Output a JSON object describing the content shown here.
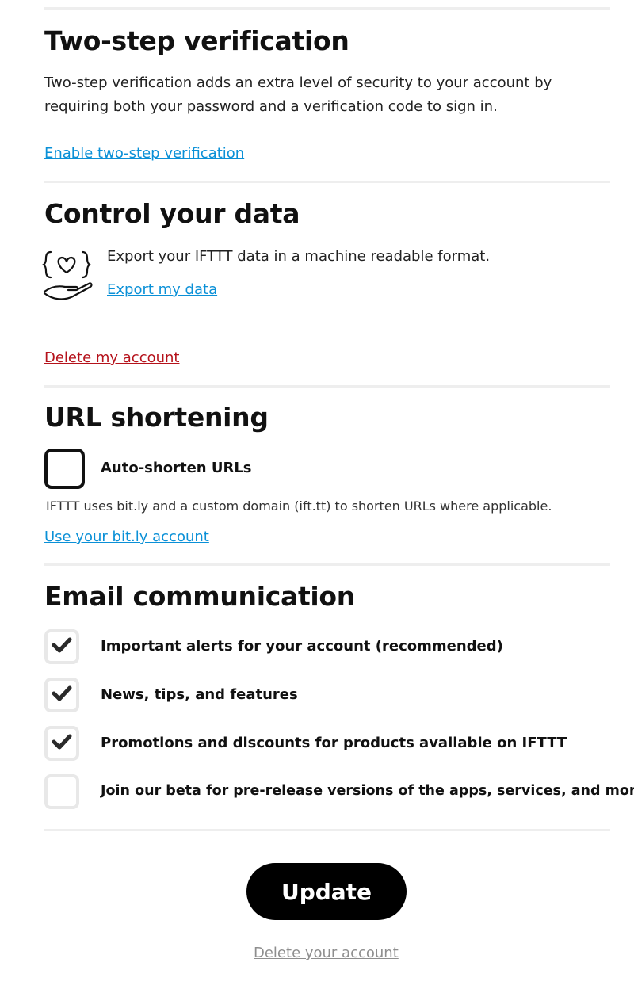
{
  "two_step": {
    "title": "Two-step verification",
    "description": "Two-step verification adds an extra level of security to your account by requiring both your password and a verification code to sign in.",
    "enable_link": "Enable two-step verification"
  },
  "control_data": {
    "title": "Control your data",
    "export_text": "Export your IFTTT data in a machine readable format.",
    "export_link": "Export my data",
    "delete_link": "Delete my account",
    "icon": "hand-heart-icon"
  },
  "url_shortening": {
    "title": "URL shortening",
    "checkbox_label": "Auto-shorten URLs",
    "checked": false,
    "note": "IFTTT uses bit.ly and a custom domain (ift.tt) to shorten URLs where applicable.",
    "bitly_link": "Use your bit.ly account"
  },
  "email": {
    "title": "Email communication",
    "options": [
      {
        "label": "Important alerts for your account (recommended)",
        "checked": true
      },
      {
        "label": "News, tips, and features",
        "checked": true
      },
      {
        "label": "Promotions and discounts for products available on IFTTT",
        "checked": true
      },
      {
        "label": "Join our beta for pre-release versions of the apps, services, and more",
        "checked": false
      }
    ]
  },
  "actions": {
    "update_label": "Update",
    "delete_account_link": "Delete your account"
  },
  "colors": {
    "link": "#0a90d7",
    "danger": "#b5121b",
    "button_bg": "#000000"
  }
}
